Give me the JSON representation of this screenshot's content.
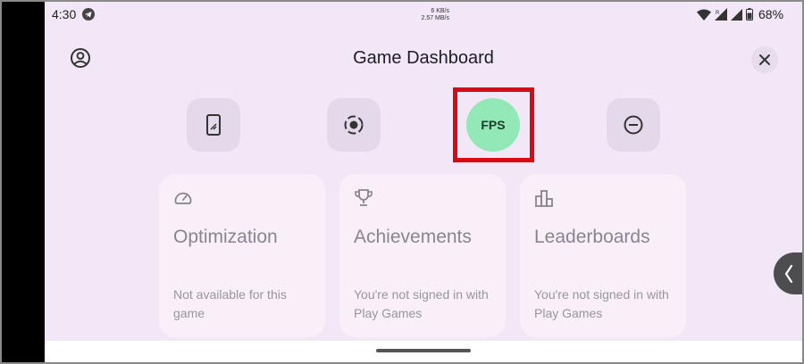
{
  "status_bar": {
    "time": "4:30",
    "net_speed_up": "6 KB/s",
    "net_speed_down": "2.57 MB/s",
    "signal_label": "R",
    "battery": "68%"
  },
  "header": {
    "title": "Game Dashboard"
  },
  "tiles": [
    {
      "name": "screen-tile",
      "icon": "phone-screen-icon"
    },
    {
      "name": "record-tile",
      "icon": "screen-record-icon"
    },
    {
      "name": "fps-tile",
      "label": "FPS",
      "active": true
    },
    {
      "name": "dnd-tile",
      "icon": "do-not-disturb-icon"
    }
  ],
  "cards": [
    {
      "icon": "speedometer-icon",
      "title": "Optimization",
      "subtitle": "Not available for this game"
    },
    {
      "icon": "trophy-icon",
      "title": "Achievements",
      "subtitle": "You're not signed in with Play Games"
    },
    {
      "icon": "leaderboard-icon",
      "title": "Leaderboards",
      "subtitle": "You're not signed in with Play Games"
    }
  ],
  "colors": {
    "background": "#f1e7f6",
    "tile": "#e3d9eb",
    "fps_active": "#93e8b8",
    "highlight": "#d40b15",
    "card": "#f8eff9"
  }
}
